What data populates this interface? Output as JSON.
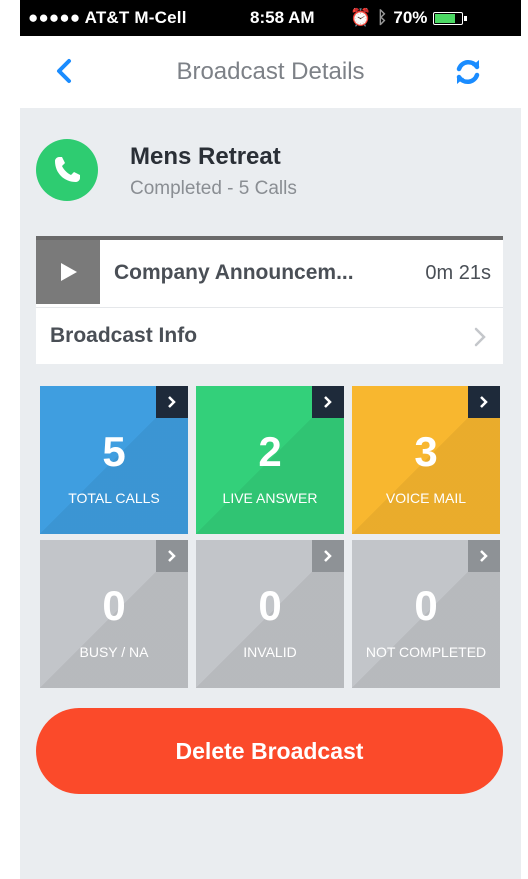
{
  "status_bar": {
    "carrier": "●●●●● AT&T M-Cell",
    "time": "8:58 AM",
    "battery": "70%"
  },
  "nav": {
    "title": "Broadcast Details"
  },
  "broadcast": {
    "name": "Mens Retreat",
    "status": "Completed - 5 Calls"
  },
  "audio": {
    "name": "Company Announcem...",
    "duration": "0m 21s"
  },
  "info": {
    "label": "Broadcast Info"
  },
  "tiles": [
    {
      "value": "5",
      "label": "TOTAL CALLS",
      "color": "#3f9ee0"
    },
    {
      "value": "2",
      "label": "LIVE ANSWER",
      "color": "#33d07a"
    },
    {
      "value": "3",
      "label": "VOICE MAIL",
      "color": "#f8b72f"
    },
    {
      "value": "0",
      "label": "BUSY / NA",
      "color": "#c2c5c9"
    },
    {
      "value": "0",
      "label": "INVALID",
      "color": "#c2c5c9"
    },
    {
      "value": "0",
      "label": "NOT COMPLETED",
      "color": "#c2c5c9"
    }
  ],
  "actions": {
    "delete_label": "Delete Broadcast"
  },
  "colors": {
    "accent": "#1a8cff",
    "success": "#2ecc71",
    "danger": "#fb4a2a"
  }
}
